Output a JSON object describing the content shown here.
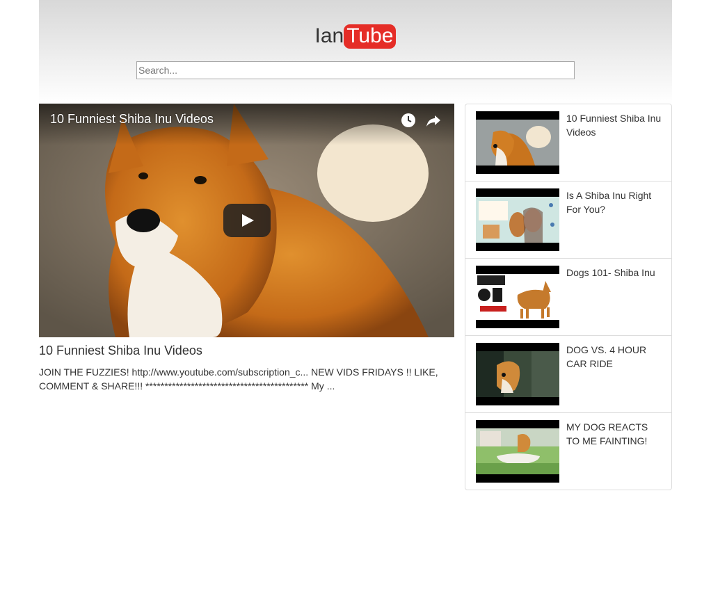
{
  "header": {
    "logo_part1": "Ian",
    "logo_part2": "Tube",
    "search_placeholder": "Search..."
  },
  "player": {
    "overlay_title": "10 Funniest Shiba Inu Videos",
    "watch_later_icon": "clock-icon",
    "share_icon": "share-icon",
    "play_icon": "play-icon"
  },
  "video": {
    "title": "10 Funniest Shiba Inu Videos",
    "description": "JOIN THE FUZZIES! http://www.youtube.com/subscription_c... NEW VIDS FRIDAYS !! LIKE, COMMENT & SHARE!!! ******************************************* My ..."
  },
  "sidebar": {
    "items": [
      {
        "title": "10 Funniest Shiba Inu Videos"
      },
      {
        "title": "Is A Shiba Inu Right For You?"
      },
      {
        "title": "Dogs 101- Shiba Inu"
      },
      {
        "title": "DOG VS. 4 HOUR CAR RIDE"
      },
      {
        "title": "MY DOG REACTS TO ME FAINTING!"
      }
    ]
  },
  "colors": {
    "brand_red": "#e52d27",
    "border": "#dddddd"
  }
}
